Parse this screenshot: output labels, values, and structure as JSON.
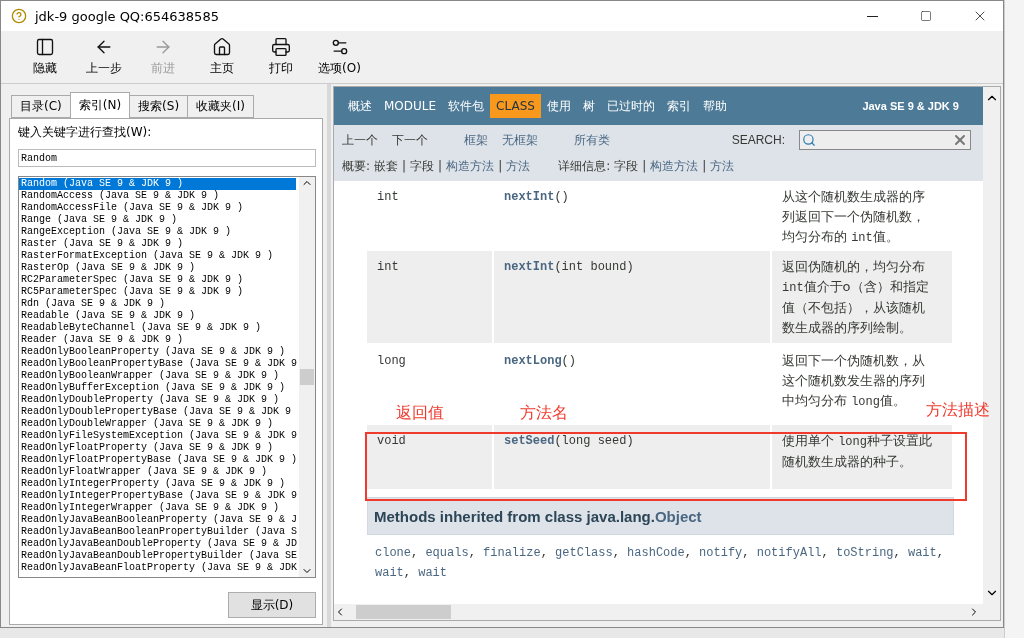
{
  "window": {
    "title": "jdk-9 google QQ:654638585"
  },
  "toolbar": [
    {
      "label": "隐藏",
      "kind": "hide",
      "disabled": false
    },
    {
      "label": "上一步",
      "kind": "back",
      "disabled": false
    },
    {
      "label": "前进",
      "kind": "forward",
      "disabled": true
    },
    {
      "label": "主页",
      "kind": "home",
      "disabled": false
    },
    {
      "label": "打印",
      "kind": "print",
      "disabled": false
    },
    {
      "label": "选项(O)",
      "kind": "options",
      "disabled": false
    }
  ],
  "tabs": [
    {
      "label": "目录(C)",
      "selected": false
    },
    {
      "label": "索引(N)",
      "selected": true
    },
    {
      "label": "搜索(S)",
      "selected": false
    },
    {
      "label": "收藏夹(I)",
      "selected": false
    }
  ],
  "index": {
    "prompt": "键入关键字进行查找(W):",
    "value": "Random",
    "button": "显示(D)",
    "items": [
      {
        "text": "Random (Java SE 9 & JDK 9 )",
        "selected": true
      },
      {
        "text": "RandomAccess (Java SE 9 & JDK 9 )",
        "selected": false
      },
      {
        "text": "RandomAccessFile (Java SE 9 & JDK 9 )",
        "selected": false
      },
      {
        "text": "Range (Java SE 9 & JDK 9 )",
        "selected": false
      },
      {
        "text": "RangeException (Java SE 9 & JDK 9 )",
        "selected": false
      },
      {
        "text": "Raster (Java SE 9 & JDK 9 )",
        "selected": false
      },
      {
        "text": "RasterFormatException (Java SE 9 & JDK 9 )",
        "selected": false
      },
      {
        "text": "RasterOp (Java SE 9 & JDK 9 )",
        "selected": false
      },
      {
        "text": "RC2ParameterSpec (Java SE 9 & JDK 9 )",
        "selected": false
      },
      {
        "text": "RC5ParameterSpec (Java SE 9 & JDK 9 )",
        "selected": false
      },
      {
        "text": "Rdn (Java SE 9 & JDK 9 )",
        "selected": false
      },
      {
        "text": "Readable (Java SE 9 & JDK 9 )",
        "selected": false
      },
      {
        "text": "ReadableByteChannel (Java SE 9 & JDK 9 )",
        "selected": false
      },
      {
        "text": "Reader (Java SE 9 & JDK 9 )",
        "selected": false
      },
      {
        "text": "ReadOnlyBooleanProperty (Java SE 9 & JDK 9 )",
        "selected": false
      },
      {
        "text": "ReadOnlyBooleanPropertyBase (Java SE 9 & JDK 9",
        "selected": false
      },
      {
        "text": "ReadOnlyBooleanWrapper (Java SE 9 & JDK 9 )",
        "selected": false
      },
      {
        "text": "ReadOnlyBufferException (Java SE 9 & JDK 9 )",
        "selected": false
      },
      {
        "text": "ReadOnlyDoubleProperty (Java SE 9 & JDK 9 )",
        "selected": false
      },
      {
        "text": "ReadOnlyDoublePropertyBase (Java SE 9 & JDK 9",
        "selected": false
      },
      {
        "text": "ReadOnlyDoubleWrapper (Java SE 9 & JDK 9 )",
        "selected": false
      },
      {
        "text": "ReadOnlyFileSystemException (Java SE 9 & JDK 9",
        "selected": false
      },
      {
        "text": "ReadOnlyFloatProperty (Java SE 9 & JDK 9 )",
        "selected": false
      },
      {
        "text": "ReadOnlyFloatPropertyBase (Java SE 9 & JDK 9 )",
        "selected": false
      },
      {
        "text": "ReadOnlyFloatWrapper (Java SE 9 & JDK 9 )",
        "selected": false
      },
      {
        "text": "ReadOnlyIntegerProperty (Java SE 9 & JDK 9 )",
        "selected": false
      },
      {
        "text": "ReadOnlyIntegerPropertyBase (Java SE 9 & JDK 9",
        "selected": false
      },
      {
        "text": "ReadOnlyIntegerWrapper (Java SE 9 & JDK 9 )",
        "selected": false
      },
      {
        "text": "ReadOnlyJavaBeanBooleanProperty (Java SE 9 & J",
        "selected": false
      },
      {
        "text": "ReadOnlyJavaBeanBooleanPropertyBuilder (Java S",
        "selected": false
      },
      {
        "text": "ReadOnlyJavaBeanDoubleProperty (Java SE 9 & JD",
        "selected": false
      },
      {
        "text": "ReadOnlyJavaBeanDoublePropertyBuilder (Java SE",
        "selected": false
      },
      {
        "text": "ReadOnlyJavaBeanFloatProperty (Java SE 9 & JDK",
        "selected": false
      }
    ]
  },
  "nav": {
    "items": [
      {
        "label": "概述",
        "selected": false
      },
      {
        "label": "MODULE",
        "selected": false
      },
      {
        "label": "软件包",
        "selected": false
      },
      {
        "label": "CLASS",
        "selected": true
      },
      {
        "label": "使用",
        "selected": false
      },
      {
        "label": "树",
        "selected": false
      },
      {
        "label": "已过时的",
        "selected": false
      },
      {
        "label": "索引",
        "selected": false
      },
      {
        "label": "帮助",
        "selected": false
      }
    ],
    "version": "Java SE 9 & JDK 9"
  },
  "subnav": {
    "links": [
      {
        "label": "上一个",
        "link": false
      },
      {
        "label": "下一个",
        "link": false
      },
      {
        "label": "框架",
        "link": true
      },
      {
        "label": "无框架",
        "link": true
      },
      {
        "label": "所有类",
        "link": true
      }
    ],
    "search_label": "SEARCH:",
    "separator": "|",
    "summary": {
      "label": "概要:",
      "items": [
        {
          "label": "嵌套",
          "link": false
        },
        {
          "label": "字段",
          "link": false
        },
        {
          "label": "构造方法",
          "link": true
        },
        {
          "label": "方法",
          "link": true
        }
      ]
    },
    "detail": {
      "label": "详细信息:",
      "items": [
        {
          "label": "字段",
          "link": false
        },
        {
          "label": "构造方法",
          "link": true
        },
        {
          "label": "方法",
          "link": true
        }
      ]
    }
  },
  "methods": [
    {
      "type": "int",
      "name": "nextInt",
      "params": "()",
      "description": [
        {
          "text": "从这个随机数生成器的序列返回下一个伪随机数，均匀分布的 ",
          "code": false
        },
        {
          "text": "int",
          "code": true
        },
        {
          "text": "值。",
          "code": false
        }
      ]
    },
    {
      "type": "int",
      "name": "nextInt",
      "params": "(int bound)",
      "description": [
        {
          "text": "返回伪随机的，均匀分布",
          "code": false
        },
        {
          "text": "int",
          "code": true
        },
        {
          "text": "值介于o（含）和指定值（不包括），从该随机数生成器的序列绘制。",
          "code": false
        }
      ]
    },
    {
      "type": "long",
      "name": "nextLong",
      "params": "()",
      "description": [
        {
          "text": "返回下一个伪随机数，从这个随机数发生器的序列中均匀分布 ",
          "code": false
        },
        {
          "text": "long",
          "code": true
        },
        {
          "text": "值。",
          "code": false
        }
      ]
    },
    {
      "type": "void",
      "name": "setSeed",
      "params": "(long seed)",
      "description": [
        {
          "text": "使用单个 ",
          "code": false
        },
        {
          "text": "long",
          "code": true
        },
        {
          "text": "种子设置此随机数生成器的种子。",
          "code": false
        }
      ]
    }
  ],
  "inherited": {
    "separator": ", ",
    "title": "Methods inherited from class java.lang.",
    "class_link": "Object",
    "methods": [
      "clone",
      "equals",
      "finalize",
      "getClass",
      "hashCode",
      "notify",
      "notifyAll",
      "toString",
      "wait",
      "wait",
      "wait"
    ]
  },
  "annotations": {
    "labels": [
      "返回值",
      "方法名",
      "方法描述"
    ]
  }
}
